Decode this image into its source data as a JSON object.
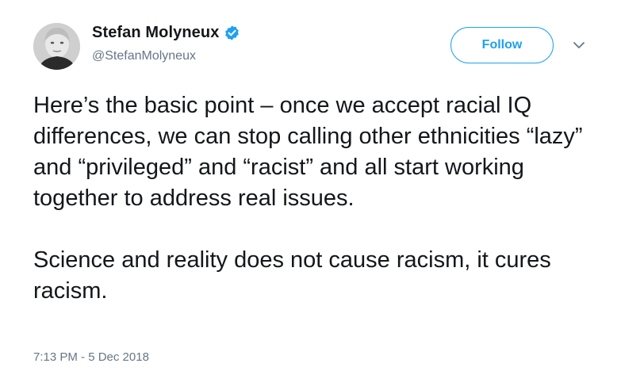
{
  "author": {
    "name": "Stefan Molyneux",
    "handle": "@StefanMolyneux",
    "verified": true
  },
  "actions": {
    "follow_label": "Follow",
    "more_icon": "chevron-down-icon"
  },
  "tweet": {
    "paragraphs": [
      "Here’s the basic point – once we accept racial IQ differences, we can stop calling other ethnicities “lazy” and “privileged” and “racist” and all start working together to address real issues.",
      "Science and reality does not cause racism, it cures racism."
    ],
    "timestamp": "7:13 PM - 5 Dec 2018"
  },
  "colors": {
    "accent": "#1da1f2",
    "text": "#14171a",
    "secondary": "#657786"
  }
}
